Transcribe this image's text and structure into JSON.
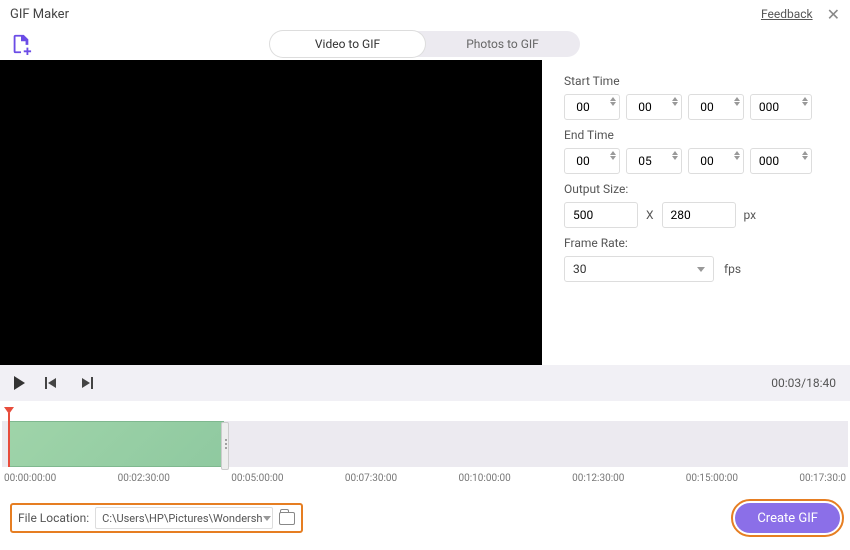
{
  "header": {
    "title": "GIF Maker",
    "feedback": "Feedback"
  },
  "tabs": {
    "video": "Video to GIF",
    "photos": "Photos to GIF"
  },
  "side": {
    "start_label": "Start Time",
    "end_label": "End Time",
    "output_label": "Output Size:",
    "frame_label": "Frame Rate:",
    "start": {
      "h": "00",
      "m": "00",
      "s": "00",
      "ms": "000"
    },
    "end": {
      "h": "00",
      "m": "05",
      "s": "00",
      "ms": "000"
    },
    "size": {
      "w": "500",
      "h": "280",
      "sep": "X",
      "unit": "px"
    },
    "frame_rate": "30",
    "fps": "fps"
  },
  "controls": {
    "time": "00:03/18:40"
  },
  "ruler": [
    "00:00:00:00",
    "00:02:30:00",
    "00:05:00:00",
    "00:07:30:00",
    "00:10:00:00",
    "00:12:30:00",
    "00:15:00:00",
    "00:17:30:0"
  ],
  "footer": {
    "file_label": "File Location:",
    "file_path": "C:\\Users\\HP\\Pictures\\Wondersh",
    "create": "Create GIF"
  }
}
